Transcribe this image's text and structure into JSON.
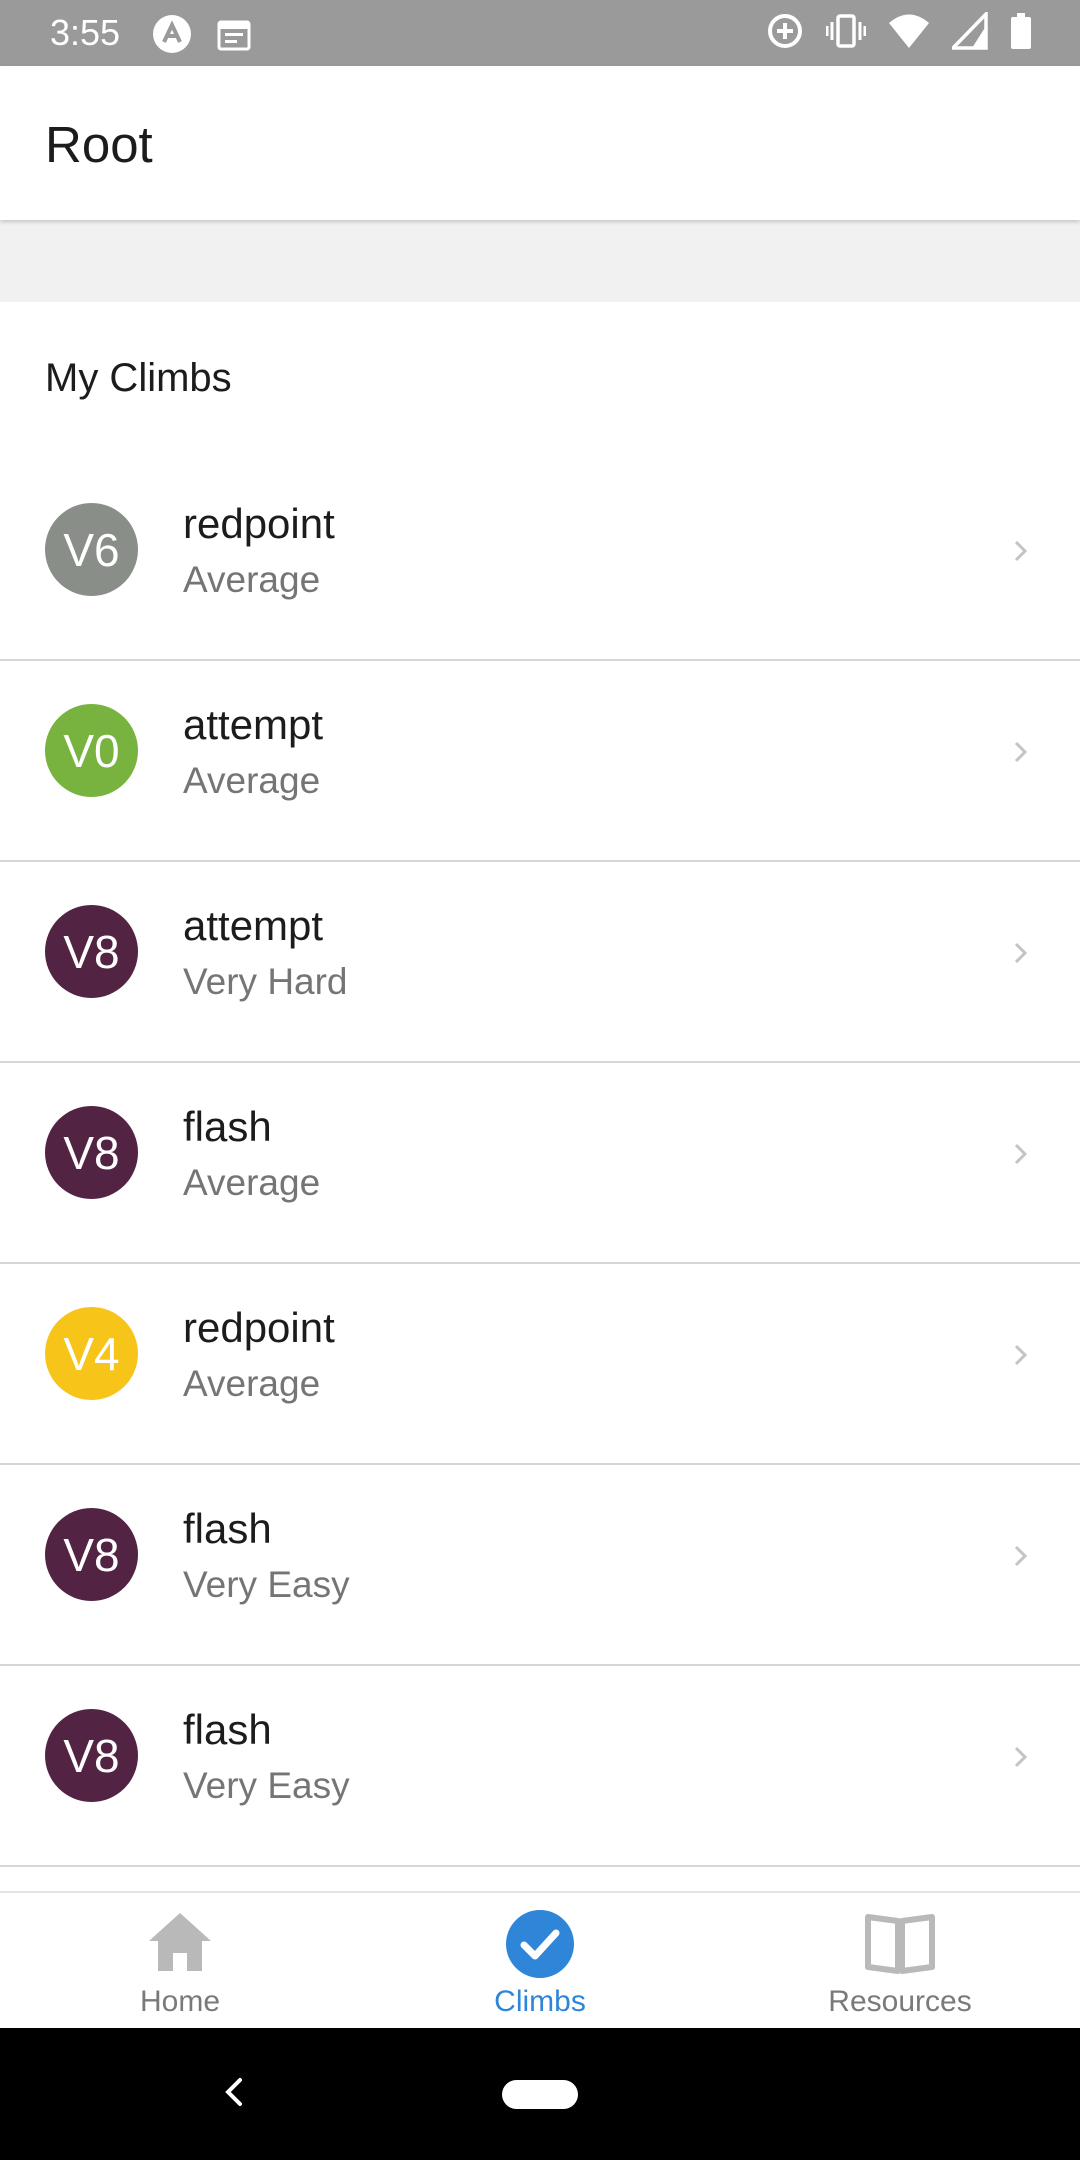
{
  "status_bar": {
    "time": "3:55",
    "left_icons": [
      "app-logo-icon",
      "calendar-icon"
    ],
    "right_icons": [
      "data-saver-icon",
      "vibrate-icon",
      "wifi-icon",
      "signal-icon",
      "battery-icon"
    ]
  },
  "header": {
    "title": "Root"
  },
  "section": {
    "title": "My Climbs"
  },
  "climbs": [
    {
      "grade": "V6",
      "type": "redpoint",
      "difficulty": "Average",
      "color": "#8a8e89"
    },
    {
      "grade": "V0",
      "type": "attempt",
      "difficulty": "Average",
      "color": "#78b340"
    },
    {
      "grade": "V8",
      "type": "attempt",
      "difficulty": "Very Hard",
      "color": "#532344"
    },
    {
      "grade": "V8",
      "type": "flash",
      "difficulty": "Average",
      "color": "#532344"
    },
    {
      "grade": "V4",
      "type": "redpoint",
      "difficulty": "Average",
      "color": "#f7c419"
    },
    {
      "grade": "V8",
      "type": "flash",
      "difficulty": "Very Easy",
      "color": "#532344"
    },
    {
      "grade": "V8",
      "type": "flash",
      "difficulty": "Very Easy",
      "color": "#532344"
    }
  ],
  "tabs": [
    {
      "label": "Home",
      "icon": "home-icon",
      "active": false
    },
    {
      "label": "Climbs",
      "icon": "checkmark-circle-icon",
      "active": true
    },
    {
      "label": "Resources",
      "icon": "book-icon",
      "active": false
    }
  ],
  "colors": {
    "accent": "#2f86d9",
    "status_bar": "#9a9a9a"
  }
}
